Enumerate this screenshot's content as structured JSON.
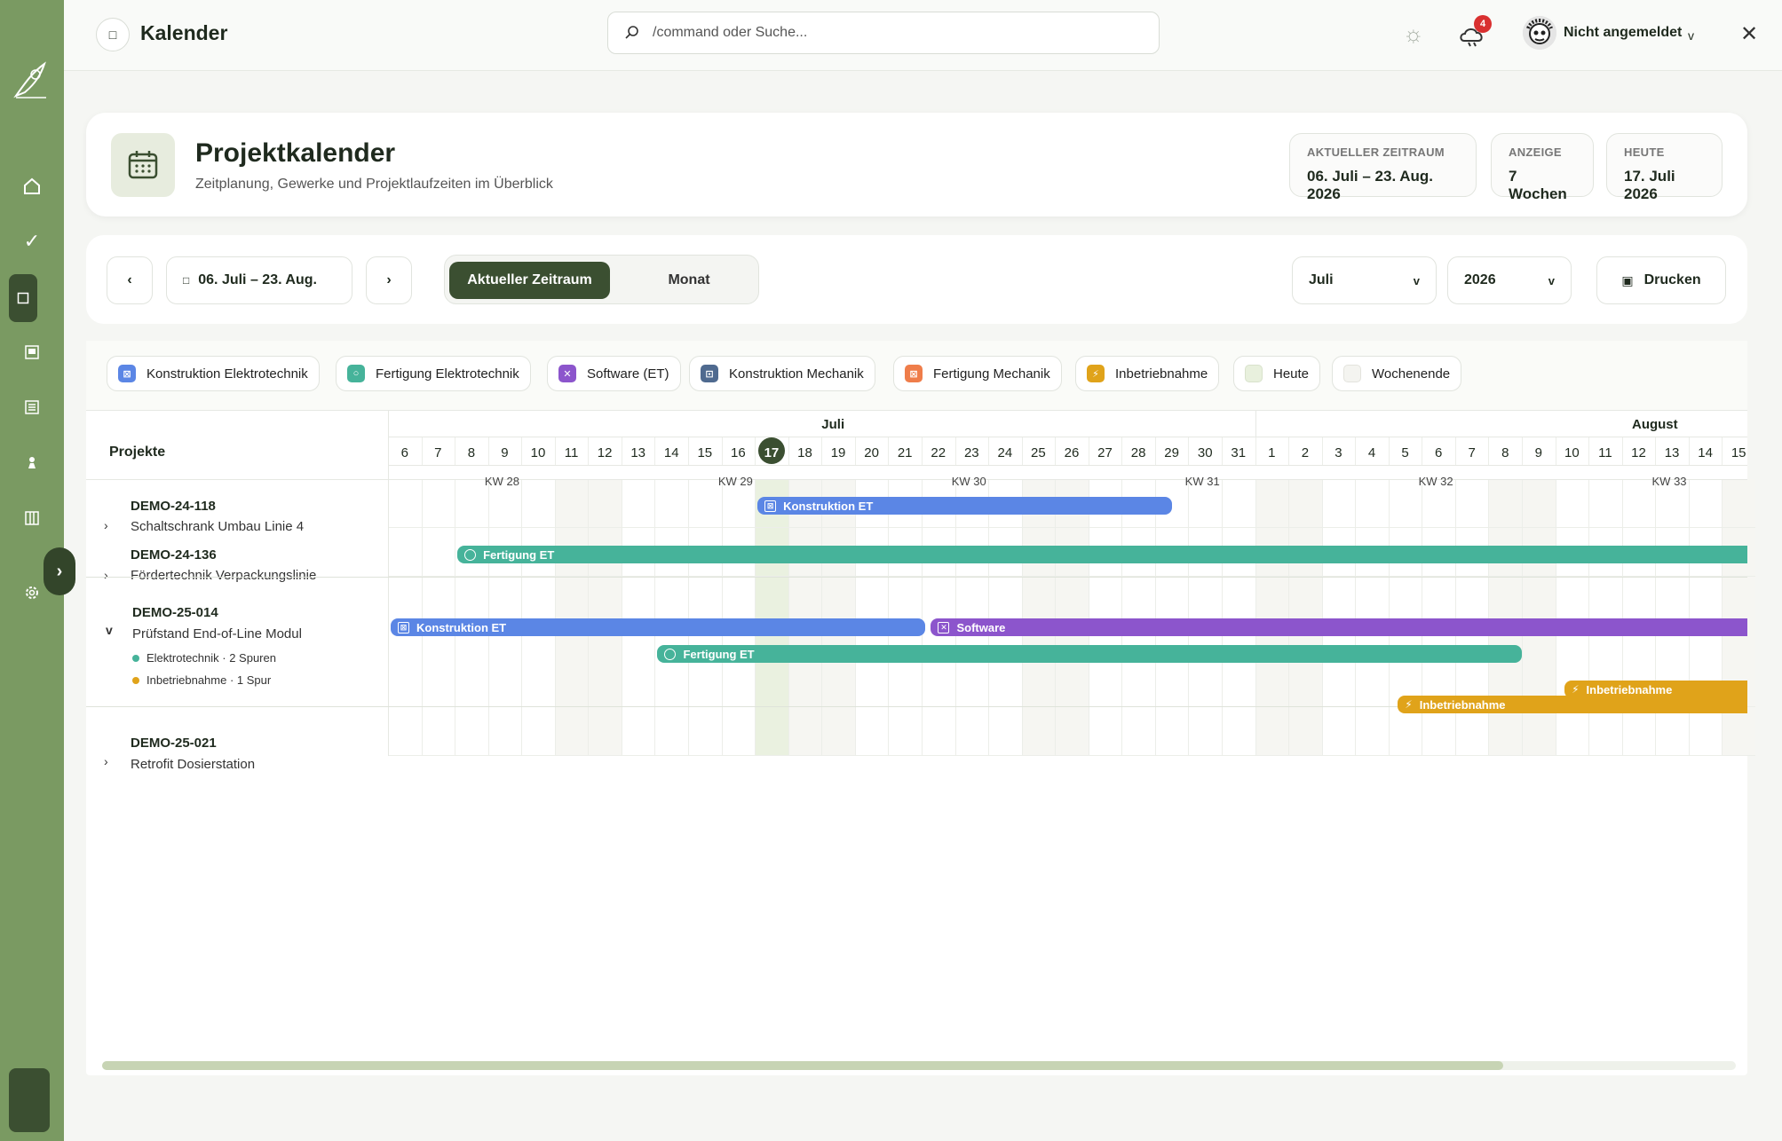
{
  "app": {
    "page_title": "Kalender",
    "search_placeholder": "/command oder Suche...",
    "notification_count": "4",
    "user_label": "Nicht angemeldet"
  },
  "header": {
    "title": "Projektkalender",
    "subtitle": "Zeitplanung, Gewerke und Projektlaufzeiten im Überblick",
    "stats": [
      {
        "label": "AKTUELLER ZEITRAUM",
        "value": "06. Juli – 23. Aug. 2026"
      },
      {
        "label": "ANZEIGE",
        "value": "7 Wochen"
      },
      {
        "label": "HEUTE",
        "value": "17. Juli 2026"
      }
    ]
  },
  "toolbar": {
    "prev": "‹",
    "next": "›",
    "range_label": "06. Juli – 23. Aug.",
    "segment_active": "Aktueller Zeitraum",
    "segment_inactive": "Monat",
    "month_select": "Juli",
    "year_select": "2026",
    "print_label": "Drucken"
  },
  "legend": [
    {
      "label": "Konstruktion Elektrotechnik",
      "color": "#5b86e5"
    },
    {
      "label": "Fertigung Elektrotechnik",
      "color": "#46b39a"
    },
    {
      "label": "Software (ET)",
      "color": "#8c55cc"
    },
    {
      "label": "Konstruktion Mechanik",
      "color": "#4f6a8f"
    },
    {
      "label": "Fertigung Mechanik",
      "color": "#ef7d4a"
    },
    {
      "label": "Inbetriebnahme",
      "color": "#e0a31a"
    },
    {
      "label": "Heute",
      "color": "#e8f0dd"
    },
    {
      "label": "Wochenende",
      "color": "#f4f4f0"
    }
  ],
  "calendar": {
    "projects_header": "Projekte",
    "months": [
      "Juli",
      "August"
    ],
    "days": [
      "6",
      "7",
      "8",
      "9",
      "10",
      "11",
      "12",
      "13",
      "14",
      "15",
      "16",
      "17",
      "18",
      "19",
      "20",
      "21",
      "22",
      "23",
      "24",
      "25",
      "26",
      "27",
      "28",
      "29",
      "30",
      "31",
      "1",
      "2",
      "3",
      "4",
      "5",
      "6",
      "7",
      "8",
      "9",
      "10",
      "11",
      "12",
      "13",
      "14",
      "15"
    ],
    "weeks": [
      "KW 28",
      "KW 29",
      "KW 30",
      "KW 31",
      "KW 32",
      "KW 33"
    ],
    "today_day": "17",
    "projects": [
      {
        "id": "DEMO-24-118",
        "name": "Schaltschrank Umbau Linie 4",
        "chevron": "›"
      },
      {
        "id": "DEMO-24-136",
        "name": "Fördertechnik Verpackungslinie",
        "chevron": "›"
      },
      {
        "id": "DEMO-25-014",
        "name": "Prüfstand End-of-Line Modul",
        "chevron": "v",
        "tracks": [
          {
            "label": "Elektrotechnik · 2 Spuren",
            "color": "#46b39a"
          },
          {
            "label": "Inbetriebnahme · 1 Spur",
            "color": "#e0a31a"
          }
        ]
      },
      {
        "id": "DEMO-25-021",
        "name": "Retrofit Dosierstation",
        "chevron": "›"
      }
    ],
    "bars": [
      {
        "label": "Konstruktion ET",
        "color": "#5b86e5",
        "start": 11,
        "end": 23.5,
        "row": 0
      },
      {
        "label": "Fertigung ET",
        "color": "#46b39a",
        "start": 2,
        "end": 41,
        "row": 1
      },
      {
        "label": "Konstruktion ET",
        "color": "#5b86e5",
        "start": 0,
        "end": 16.1,
        "row": 2
      },
      {
        "label": "Software",
        "color": "#8c55cc",
        "start": 16.2,
        "end": 41,
        "row": 3
      },
      {
        "label": "Fertigung ET",
        "color": "#46b39a",
        "start": 8,
        "end": 34,
        "row": 4
      },
      {
        "label": "Inbetriebnahme",
        "color": "#e0a31a",
        "start": 35.2,
        "end": 41,
        "row": 5
      },
      {
        "label": "Inbetriebnahme",
        "color": "#e0a31a",
        "start": 30.2,
        "end": 41,
        "row": 6
      }
    ]
  }
}
